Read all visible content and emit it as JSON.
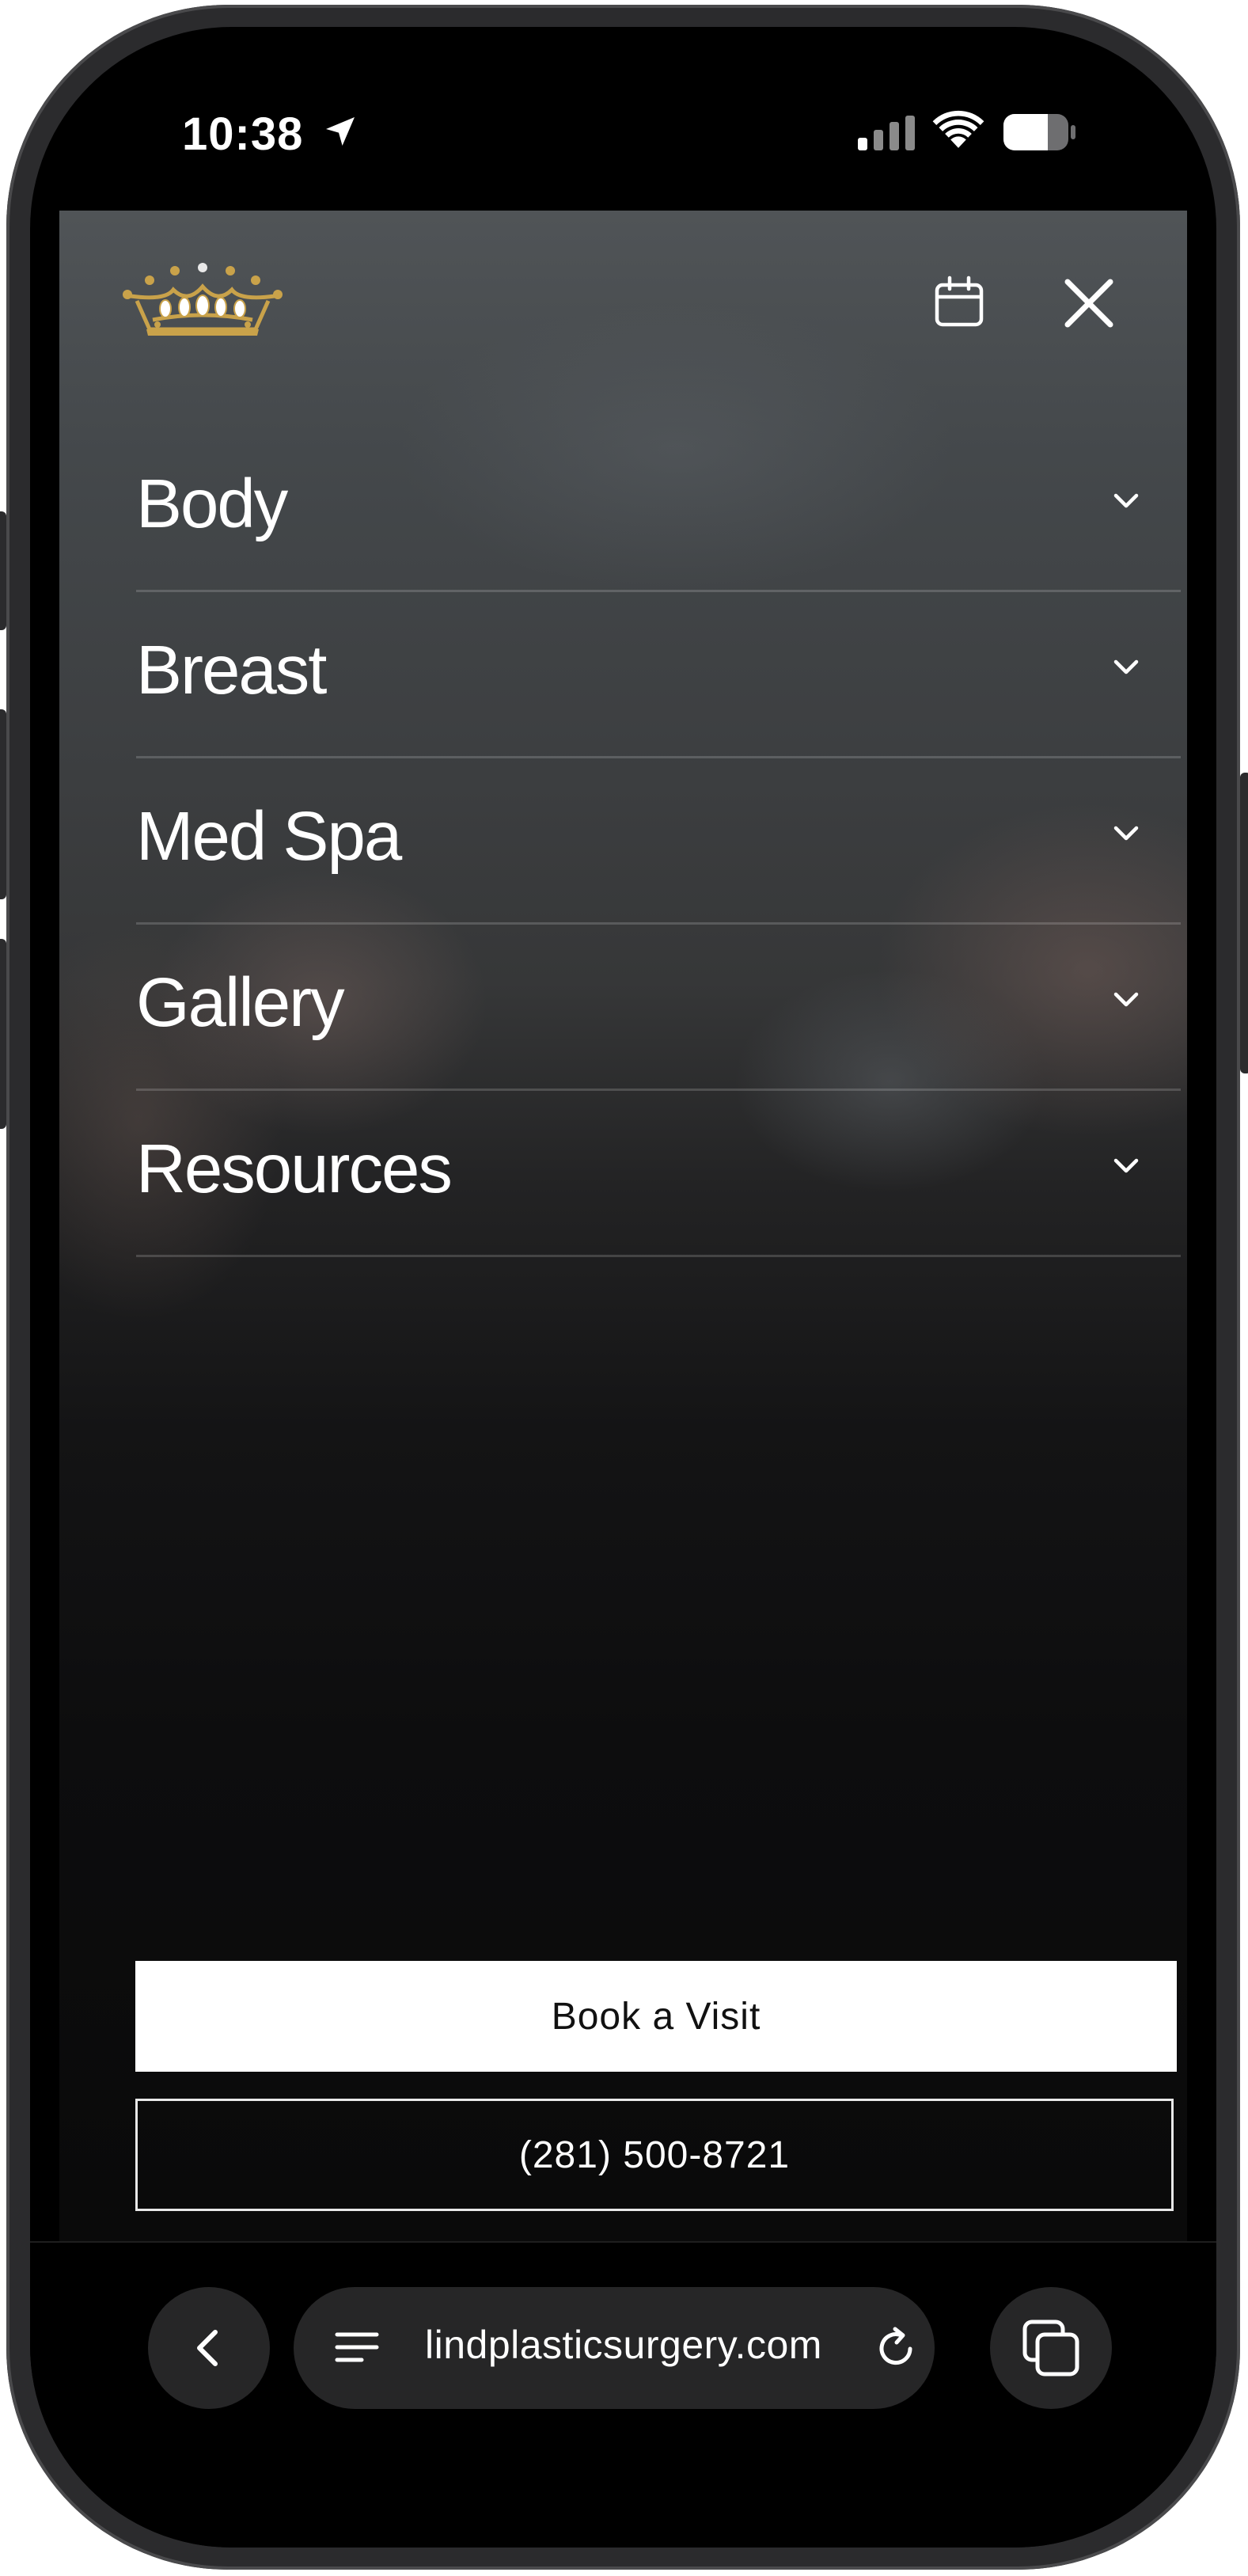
{
  "status_bar": {
    "time": "10:38",
    "icons": [
      "location-arrow-icon",
      "cellular-signal-icon",
      "wifi-icon",
      "battery-icon"
    ]
  },
  "header": {
    "logo": "crown-logo",
    "icons": [
      "calendar-icon",
      "close-icon"
    ]
  },
  "menu": {
    "items": [
      {
        "label": "Body"
      },
      {
        "label": "Breast"
      },
      {
        "label": "Med Spa"
      },
      {
        "label": "Gallery"
      },
      {
        "label": "Resources"
      }
    ],
    "expand_icon": "chevron-down-icon"
  },
  "cta": {
    "book_label": "Book a Visit",
    "phone_label": "(281) 500-8721"
  },
  "browser": {
    "url": "lindplasticsurgery.com",
    "icons": [
      "back-chevron-icon",
      "page-menu-icon",
      "reload-icon",
      "tabs-icon"
    ]
  },
  "colors": {
    "accent_gold": "#c9a24a",
    "background": "#0b0b0b",
    "text": "#ffffff"
  }
}
